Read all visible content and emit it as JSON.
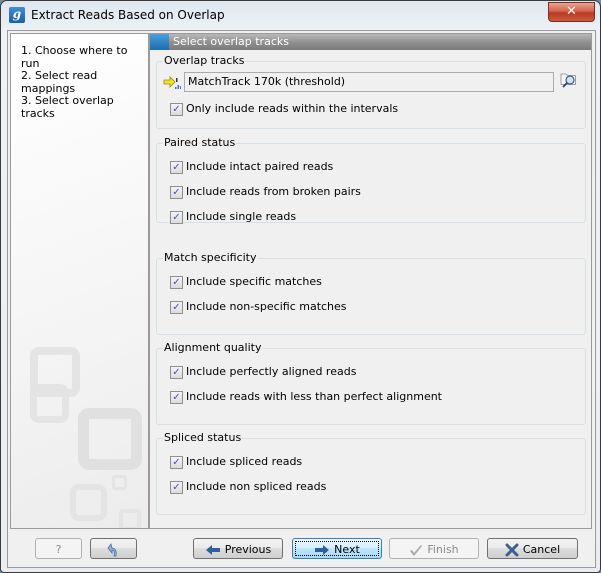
{
  "window": {
    "title": "Extract Reads Based on Overlap",
    "app_icon_glyph": "g",
    "close_glyph": "✕"
  },
  "steps": [
    {
      "label": "1.  Choose where to run"
    },
    {
      "label": "2.  Select read mappings"
    },
    {
      "label": "3.  Select overlap tracks"
    }
  ],
  "panel": {
    "header": "Select overlap tracks",
    "groups": {
      "overlap": {
        "title": "Overlap tracks",
        "track_value": "MatchTrack 170k (threshold)",
        "options": [
          {
            "label": "Only include reads within the intervals",
            "checked": true
          }
        ]
      },
      "paired": {
        "title": "Paired status",
        "options": [
          {
            "label": "Include intact paired reads",
            "checked": true
          },
          {
            "label": "Include reads from broken pairs",
            "checked": true
          },
          {
            "label": "Include single reads",
            "checked": true
          }
        ]
      },
      "match": {
        "title": "Match specificity",
        "options": [
          {
            "label": "Include specific matches",
            "checked": true
          },
          {
            "label": "Include non-specific matches",
            "checked": true
          }
        ]
      },
      "alignment": {
        "title": "Alignment quality",
        "options": [
          {
            "label": "Include perfectly aligned reads",
            "checked": true
          },
          {
            "label": "Include reads with less than perfect alignment",
            "checked": true
          }
        ]
      },
      "spliced": {
        "title": "Spliced status",
        "options": [
          {
            "label": "Include spliced reads",
            "checked": true
          },
          {
            "label": "Include non spliced reads",
            "checked": true
          }
        ]
      }
    }
  },
  "buttons": {
    "help": "?",
    "previous": "Previous",
    "next": "Next",
    "finish": "Finish",
    "cancel": "Cancel"
  },
  "check_glyph": "✓"
}
